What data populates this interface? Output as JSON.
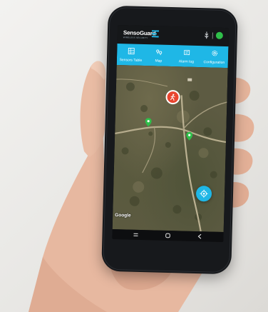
{
  "app": {
    "logo_text": "SensoGuard",
    "logo_subtext": "WIRELESS SECURITY"
  },
  "tabs": [
    {
      "label": "Sensors Table",
      "icon": "sensors-table-icon"
    },
    {
      "label": "Map",
      "icon": "map-icon"
    },
    {
      "label": "Alarm log",
      "icon": "alarm-log-icon"
    },
    {
      "label": "Configuration",
      "icon": "gear-icon"
    }
  ],
  "map": {
    "attribution": "Google",
    "markers": [
      {
        "type": "alarm",
        "icon": "running-person-icon",
        "color": "#e8452f"
      },
      {
        "type": "sensor",
        "color": "#2fbf4a"
      },
      {
        "type": "sensor",
        "color": "#2fbf4a"
      }
    ]
  },
  "status": {
    "connection_color": "#2fbf4a"
  },
  "colors": {
    "accent": "#1fb7e6",
    "alarm": "#e8452f",
    "ok": "#2fbf4a"
  }
}
